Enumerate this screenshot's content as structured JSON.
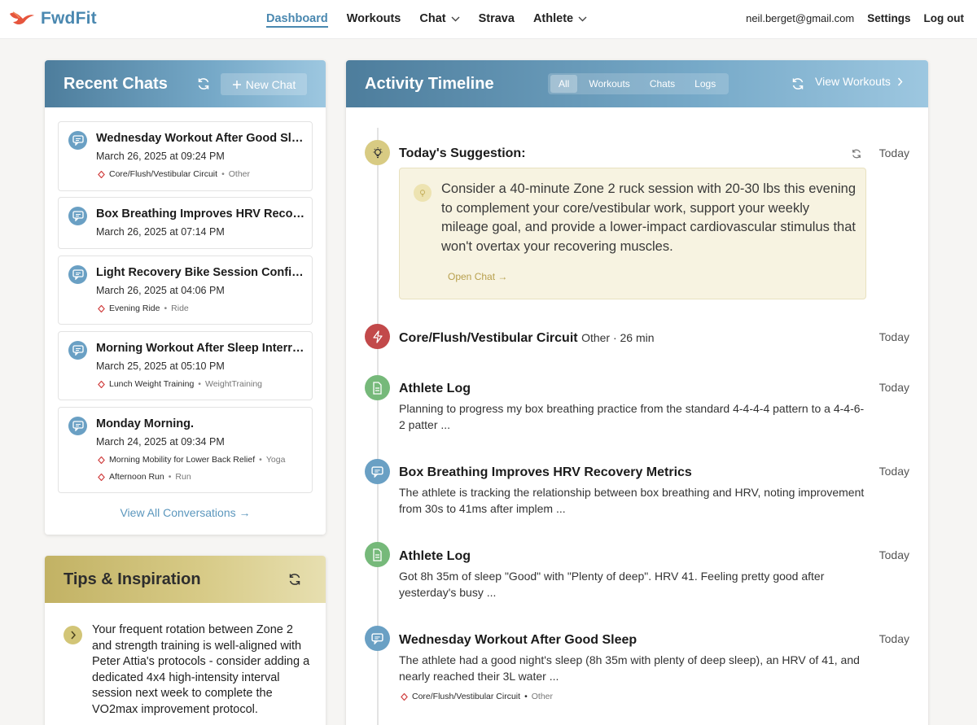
{
  "app": {
    "name": "FwdFit",
    "nav": [
      {
        "label": "Dashboard"
      },
      {
        "label": "Workouts"
      },
      {
        "label": "Chat"
      },
      {
        "label": "Strava"
      },
      {
        "label": "Athlete"
      }
    ],
    "email": "neil.berget@gmail.com",
    "settings_label": "Settings",
    "logout_label": "Log out"
  },
  "recent_chats": {
    "title": "Recent Chats",
    "new_chat_label": "New Chat",
    "items": [
      {
        "title": "Wednesday Workout After Good Sleep",
        "date": "March 26, 2025 at 09:24 PM",
        "tags": [
          {
            "name": "Core/Flush/Vestibular Circuit",
            "type": "Other"
          }
        ]
      },
      {
        "title": "Box Breathing Improves HRV Recovery Metrics",
        "date": "March 26, 2025 at 07:14 PM",
        "tags": []
      },
      {
        "title": "Light Recovery Bike Session Confirmed",
        "date": "March 26, 2025 at 04:06 PM",
        "tags": [
          {
            "name": "Evening Ride",
            "type": "Ride"
          }
        ]
      },
      {
        "title": "Morning Workout After Sleep Interruption",
        "date": "March 25, 2025 at 05:10 PM",
        "tags": [
          {
            "name": "Lunch Weight Training",
            "type": "WeightTraining"
          }
        ]
      },
      {
        "title": "Monday Morning.",
        "date": "March 24, 2025 at 09:34 PM",
        "tags": [
          {
            "name": "Morning Mobility for Lower Back Relief",
            "type": "Yoga"
          },
          {
            "name": "Afternoon Run",
            "type": "Run"
          }
        ]
      }
    ],
    "view_all_label": "View All Conversations →"
  },
  "tips": {
    "title": "Tips & Inspiration",
    "text": "Your frequent rotation between Zone 2 and strength training is well-aligned with Peter Attia's protocols - consider adding a dedicated 4x4 high-intensity interval session next week to complete the VO2max improvement protocol."
  },
  "timeline": {
    "title": "Activity Timeline",
    "filters": [
      {
        "label": "All"
      },
      {
        "label": "Workouts"
      },
      {
        "label": "Chats"
      },
      {
        "label": "Logs"
      }
    ],
    "view_workouts_label": "View Workouts",
    "suggestion": {
      "title": "Today's Suggestion:",
      "time": "Today",
      "text": "Consider a 40-minute Zone 2 ruck session with 20-30 lbs this evening to complement your core/vestibular work, support your weekly mileage goal, and provide a lower-impact cardiovascular stimulus that won't overtax your recovering muscles.",
      "open_chat_label": "Open Chat →"
    },
    "entries": [
      {
        "kind": "workout",
        "title": "Core/Flush/Vestibular Circuit",
        "subtitle": "Other · 26 min",
        "time": "Today"
      },
      {
        "kind": "log",
        "title": "Athlete Log",
        "time": "Today",
        "body": "Planning to progress my box breathing practice from the standard 4-4-4-4 pattern to a 4-4-6-2 patter ..."
      },
      {
        "kind": "chat",
        "title": "Box Breathing Improves HRV Recovery Metrics",
        "time": "Today",
        "body": "The athlete is tracking the relationship between box breathing and HRV, noting improvement from 30s to 41ms after implem ..."
      },
      {
        "kind": "log",
        "title": "Athlete Log",
        "time": "Today",
        "body": "Got 8h 35m of sleep \"Good\" with \"Plenty of deep\". HRV 41. Feeling pretty good after yesterday's busy ..."
      },
      {
        "kind": "chat",
        "title": "Wednesday Workout After Good Sleep",
        "time": "Today",
        "body": "The athlete had a good night's sleep (8h 35m with plenty of deep sleep), an HRV of 41, and nearly reached their 3L water ...",
        "tag": {
          "name": "Core/Flush/Vestibular Circuit",
          "type": "Other"
        }
      }
    ]
  }
}
